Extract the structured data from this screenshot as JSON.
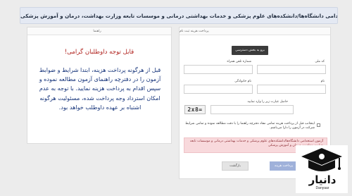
{
  "header": {
    "title": "آزمون استخدامی دانشگاه‌ها/دانشکده‌های علوم پزشکی و خدمات بهداشتی درمانی و موسسات تابعه وزارت بهداشت، درمان و آموزش پزشکی"
  },
  "payment_panel": {
    "title": "پرداخت هزینه ثبت نام",
    "download_button": "برو به بخش دسترسی",
    "fields": {
      "national_code_label": "کد ملی",
      "mobile_label": "شماره تلفن همراه",
      "first_name_label": "نام",
      "last_name_label": "نام خانوادگی",
      "captcha_label": "حاصل عبارت زیر را وارد نمایید",
      "captcha_text": "2x8="
    },
    "agreement_text": "اینجانب قبل از پرداخت هزینه تمامی مفاد دفترچه راهنما را با دقت مطالعه نموده و تمامی شرایط شرکت در آزمون را دارا می‌باشم.",
    "alert_text": "آزمون استخدامی دانشگاه‌ها/دانشکده‌های علوم پزشکی و خدمات بهداشتی درمانی و موسسات تابعه وزارت بهداشت، درمان و آموزش پزشکی",
    "pay_button": "پرداخت هزینه",
    "back_button": "بازگشت"
  },
  "guide_panel": {
    "title": "راهنما",
    "notice_title": "قابل توجه داوطلبان گرامی!",
    "notice_body": "قبل از هرگونه پرداخت هزینه، ابتدا شرایط و ضوابط آزمون را در دفترچه راهنمای آزمون مطالعه نموده و سپس اقدام به پرداخت هزینه نمایید. با توجه به عدم امکان استرداد وجه پرداخت شده، مسئولیت هرگونه اشتباه بر عهده داوطلب خواهد بود."
  },
  "logo": {
    "name": "دانیار",
    "sub": "Danyaar"
  }
}
